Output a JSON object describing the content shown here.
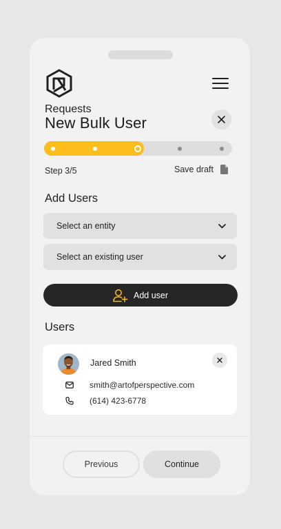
{
  "header": {
    "breadcrumb": "Requests",
    "title": "New Bulk User"
  },
  "progress": {
    "total_steps": 5,
    "current_step": 3,
    "fill_fraction": 0.53,
    "step_text": "Step 3/5",
    "save_draft_label": "Save draft",
    "accent_color": "#fbbe1a"
  },
  "add_users": {
    "heading": "Add Users",
    "entity_select": "Select an entity",
    "user_select": "Select an existing user",
    "add_button_label": "Add user"
  },
  "users": {
    "heading": "Users",
    "list": [
      {
        "name": "Jared Smith",
        "email": "smith@artofperspective.com",
        "phone": "(614) 423-6778"
      }
    ]
  },
  "footer": {
    "previous_label": "Previous",
    "continue_label": "Continue"
  },
  "icons": {
    "logo": "hexagon-logo-icon",
    "menu": "hamburger-menu-icon",
    "close": "close-icon",
    "draft": "document-icon",
    "chevron": "chevron-down-icon",
    "add_user": "user-plus-icon",
    "email": "envelope-icon",
    "phone": "phone-icon"
  }
}
